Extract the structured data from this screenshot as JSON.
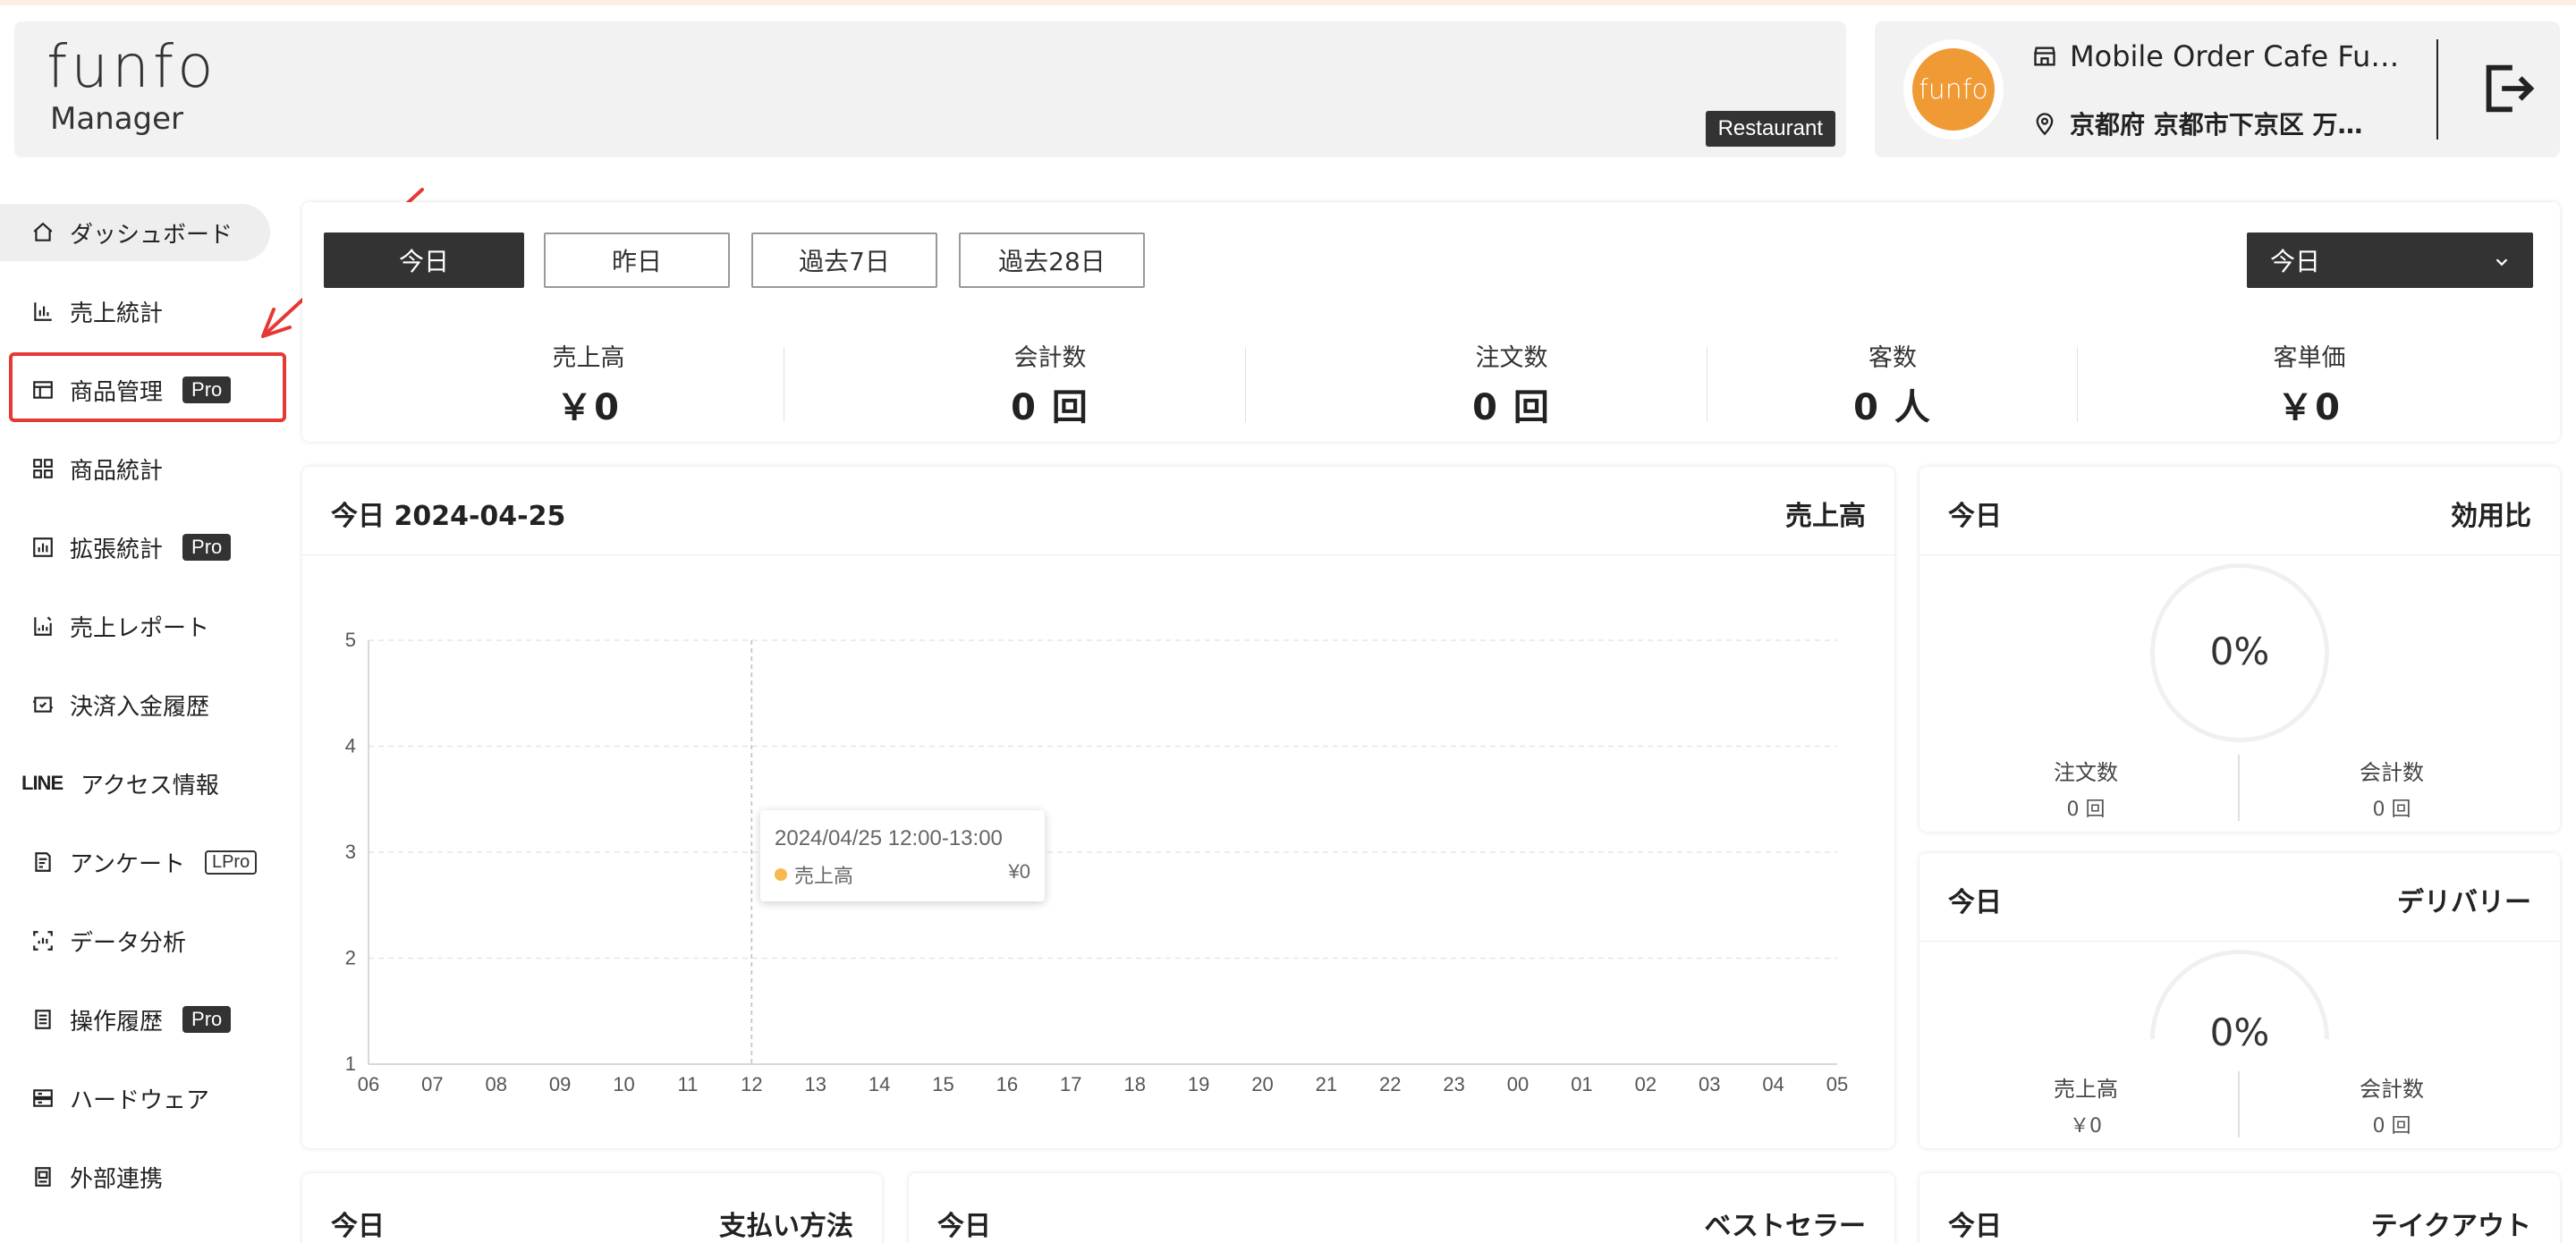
{
  "header": {
    "logo_text": "funfo",
    "logo_sub": "Manager",
    "restaurant_tag": "Restaurant",
    "store_name": "Mobile Order Cafe Fu…",
    "store_address": "京都府 京都市下京区 万…",
    "avatar_text": "funfo"
  },
  "sidebar": {
    "items": [
      {
        "label": "ダッシュボード"
      },
      {
        "label": "売上統計"
      },
      {
        "label": "商品管理",
        "badge": "Pro"
      },
      {
        "label": "商品統計"
      },
      {
        "label": "拡張統計",
        "badge": "Pro"
      },
      {
        "label": "売上レポート"
      },
      {
        "label": "決済入金履歴"
      },
      {
        "label": "アクセス情報",
        "prefix": "LINE"
      },
      {
        "label": "アンケート",
        "badge": "LPro"
      },
      {
        "label": "データ分析"
      },
      {
        "label": "操作履歴",
        "badge": "Pro"
      },
      {
        "label": "ハードウェア"
      },
      {
        "label": "外部連携"
      }
    ]
  },
  "range": {
    "buttons": [
      "今日",
      "昨日",
      "過去7日",
      "過去28日"
    ],
    "selected": "今日"
  },
  "kpis": [
    {
      "label": "売上高",
      "value": "￥0"
    },
    {
      "label": "会計数",
      "value": "0 回"
    },
    {
      "label": "注文数",
      "value": "0 回"
    },
    {
      "label": "客数",
      "value": "0 人"
    },
    {
      "label": "客単価",
      "value": "￥0"
    }
  ],
  "chart_panel": {
    "title": "今日 2024-04-25",
    "metric": "売上高",
    "tooltip_time": "2024/04/25 12:00-13:00",
    "tooltip_series": "売上高",
    "tooltip_value": "¥0"
  },
  "chart_data": {
    "type": "line",
    "x": [
      "06",
      "07",
      "08",
      "09",
      "10",
      "11",
      "12",
      "13",
      "14",
      "15",
      "16",
      "17",
      "18",
      "19",
      "20",
      "21",
      "22",
      "23",
      "00",
      "01",
      "02",
      "03",
      "04",
      "05"
    ],
    "series": [
      {
        "name": "売上高",
        "values": [
          0,
          0,
          0,
          0,
          0,
          0,
          0,
          0,
          0,
          0,
          0,
          0,
          0,
          0,
          0,
          0,
          0,
          0,
          0,
          0,
          0,
          0,
          0,
          0
        ]
      }
    ],
    "yticks": [
      1,
      2,
      3,
      4,
      5
    ],
    "ylim": [
      1,
      5
    ],
    "grid": true,
    "hover_index": 6,
    "series_color": "#f5b94e"
  },
  "ratio_panel": {
    "title": "今日",
    "metric": "効用比",
    "percent": "0%",
    "left_label": "注文数",
    "left_value": "0 回",
    "right_label": "会計数",
    "right_value": "0 回"
  },
  "delivery_panel": {
    "title": "今日",
    "metric": "デリバリー",
    "percent": "0%",
    "left_label": "売上高",
    "left_value": "￥0",
    "right_label": "会計数",
    "right_value": "0 回"
  },
  "bottom_panels": [
    {
      "title": "今日",
      "metric": "支払い方法"
    },
    {
      "title": "今日",
      "metric": "ベストセラー"
    },
    {
      "title": "今日",
      "metric": "テイクアウト"
    }
  ],
  "colors": {
    "accent": "#333333",
    "brand_orange": "#f09a35",
    "highlight_red": "#e53935"
  }
}
